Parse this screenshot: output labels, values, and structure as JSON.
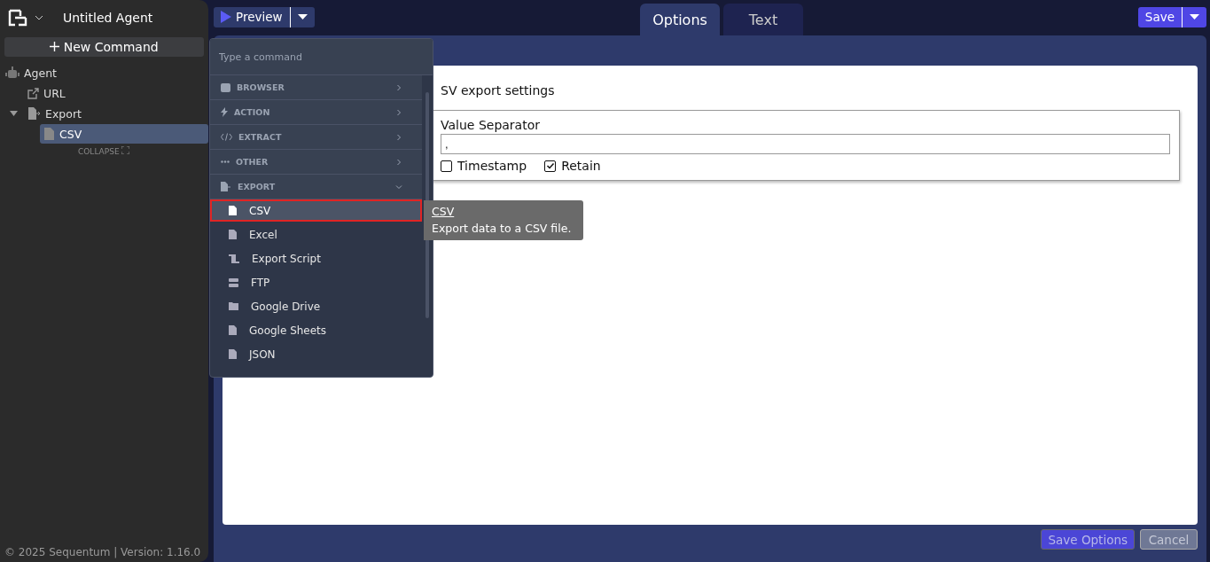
{
  "sidebar": {
    "title": "Untitled Agent",
    "new_command": "New Command",
    "tree": [
      {
        "label": "Agent",
        "selected": false,
        "children": [
          {
            "label": "URL",
            "selected": false
          },
          {
            "label": "Export",
            "expanded": true,
            "selected": false,
            "children": [
              {
                "label": "CSV",
                "selected": true
              }
            ]
          }
        ]
      }
    ],
    "collapse": "COLLAPSE",
    "footer": "© 2025 Sequentum | Version: 1.16.0"
  },
  "toolbar": {
    "preview": "Preview",
    "tabs": [
      {
        "label": "Options",
        "selected": true
      },
      {
        "label": "Text",
        "selected": false
      }
    ],
    "save": "Save"
  },
  "form": {
    "title": "SV export settings",
    "separator_label": "Value Separator",
    "separator_value": ",",
    "checkboxes": [
      {
        "label": "Timestamp",
        "checked": false
      },
      {
        "label": "Retain",
        "checked": true
      }
    ]
  },
  "menu": {
    "placeholder": "Type a command",
    "categories": [
      {
        "label": "BROWSER",
        "expanded": false
      },
      {
        "label": "ACTION",
        "expanded": false
      },
      {
        "label": "EXTRACT",
        "expanded": false
      },
      {
        "label": "OTHER",
        "expanded": false
      },
      {
        "label": "EXPORT",
        "expanded": true,
        "items": [
          {
            "label": "CSV",
            "selected": true
          },
          {
            "label": "Excel",
            "selected": false
          },
          {
            "label": "Export Script",
            "selected": false
          },
          {
            "label": "FTP",
            "selected": false
          },
          {
            "label": "Google Drive",
            "selected": false
          },
          {
            "label": "Google Sheets",
            "selected": false
          },
          {
            "label": "JSON",
            "selected": false
          }
        ]
      }
    ]
  },
  "tooltip": {
    "title": "CSV",
    "text": "Export data to a CSV file."
  },
  "actions": {
    "save_options": "Save Options",
    "cancel": "Cancel",
    "cancel_disabled": true
  }
}
